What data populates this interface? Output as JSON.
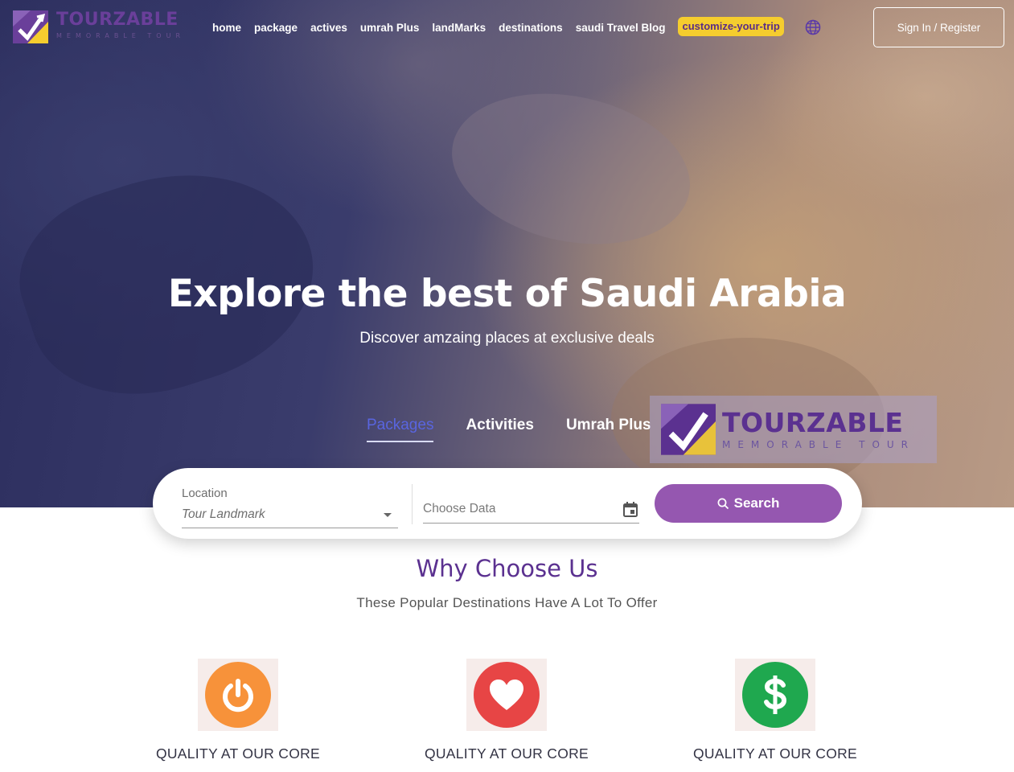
{
  "brand": {
    "name": "TOURZABLE",
    "tagline": "MEMORABLE TOUR"
  },
  "nav": {
    "items": [
      "home",
      "package",
      "actives",
      "umrah Plus",
      "landMarks",
      "destinations",
      "saudi Travel Blog"
    ],
    "cta": "customize-your-trip",
    "globe_icon": "globe-icon",
    "signin": "Sign In / Register"
  },
  "hero": {
    "title": "Explore the best of Saudi Arabia",
    "subtitle": "Discover amzaing places at exclusive deals",
    "tabs": [
      "Packages",
      "Activities",
      "Umrah Plus"
    ],
    "active_tab": "Packages"
  },
  "search": {
    "location_label": "Location",
    "location_value": "Tour Landmark",
    "date_placeholder": "Choose Data",
    "button_label": "Search"
  },
  "why": {
    "title": "Why Choose Us",
    "subtitle": "These Popular Destinations Have A Lot To Offer",
    "features": [
      {
        "icon": "power-icon",
        "color": "#f7923a",
        "label": "QUALITY AT OUR CORE"
      },
      {
        "icon": "heart-icon",
        "color": "#e74545",
        "label": "QUALITY AT OUR CORE"
      },
      {
        "icon": "dollar-icon",
        "color": "#1fa84f",
        "label": "QUALITY AT OUR CORE"
      }
    ]
  },
  "colors": {
    "brand_purple": "#5b3190",
    "accent_yellow": "#f5cd2e",
    "button_purple": "#9557b0",
    "tab_active": "#5965e0"
  }
}
